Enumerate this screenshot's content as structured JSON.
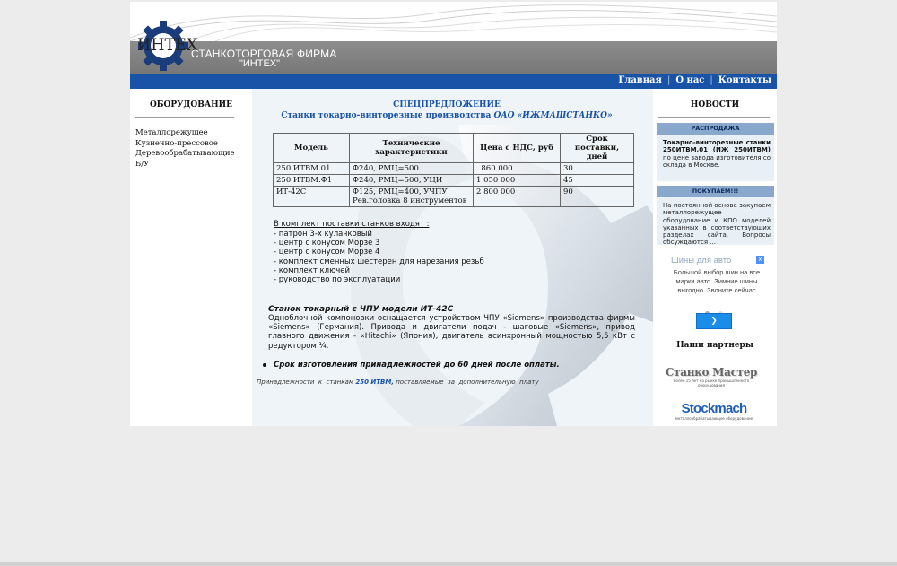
{
  "header": {
    "logo_text": "ИНТЕХ",
    "firm_line1": "СТАНКОТОРГОВАЯ ФИРМА",
    "firm_line2": "\"ИНТЕХ\""
  },
  "nav": {
    "items": [
      {
        "label": "Главная"
      },
      {
        "label": "О нас"
      },
      {
        "label": "Контакты"
      }
    ]
  },
  "sidebar": {
    "title": "ОБОРУДОВАНИЕ",
    "items": [
      {
        "label": "Металлорежущее"
      },
      {
        "label": "Кузнечно-прессовое"
      },
      {
        "label": "Деревообрабатывающие"
      },
      {
        "label": "Б/У"
      }
    ]
  },
  "main": {
    "title": "СПЕЦПРЕДЛОЖЕНИЕ",
    "subtitle": "Станки токарно-винторезные  производства",
    "subtitle_company": "ОАО «ИЖМАШСТАНКО»",
    "table": {
      "headers": [
        "Модель",
        "Технические характеристики",
        "Цена   с  НДС, руб",
        "Срок поставки, дней"
      ],
      "rows": [
        [
          "250 ИТВМ.01",
          "Ф240, РМЦ=500",
          "  860 000",
          "30"
        ],
        [
          "250 ИТВМ.Ф1",
          "Ф240, РМЦ=500, УЦИ",
          "1 050 000",
          "45"
        ],
        [
          "ИТ-42С",
          "Ф125, РМЦ=400, УЧПУ Рев.головка 8 инструментов",
          "2 800 000",
          "90"
        ]
      ]
    },
    "kit_title": "В комплект поставки станков  входят :",
    "kit_items": [
      "- патрон 3-х кулачковый",
      "- центр с конусом Морзе 3",
      "- центр с конусом Морзе 4",
      "- комплект сменных шестерен для нарезания резьб",
      "- комплект ключей",
      "- руководство по эксплуатации"
    ],
    "cnc_title": "Станок токарный с ЧПУ  модели  ИТ-42С",
    "cnc_text": "Одноблочной  компоновки оснащается устройством ЧПУ «Siemens»  производства фирмы «Siemens»  (Германия). Привода и двигатели подач - шаговые «Siemens», привод главного движения - «Hitachi» (Япония), двигатель асинхронный мощностью 5,5 кВт с редуктором  ¼.",
    "term": "Срок изготовления принадлежностей до 60 дней после  оплаты.",
    "footnote_pre": "Принадлежности  к  станкам ",
    "footnote_bold": "250 ИТВМ,",
    "footnote_post": " поставляемые  за  дополнительную  плату"
  },
  "news": {
    "title": "НОВОСТИ",
    "items": [
      {
        "head": "РАСПРОДАЖА",
        "body_bold": "Токарно-винторезные станки 250ИТВМ.01 (ИЖ 250ИТВМ)",
        "body": " по цене завода изготовителя со склада в Москве."
      },
      {
        "head": "ПОКУПАЕМ!!!",
        "body_bold": "",
        "body": "На постоянной основе закупаем металлорежущее оборудование и КПО моделей указанных в соответствующих разделах сайта. Вопросы обсуждаются ..."
      }
    ]
  },
  "ad": {
    "headline": "Шины для авто",
    "text": "Большой выбор шин на все марки авто. Зимние шины выгодно. Звоните сейчас",
    "close_glyph": "x",
    "button_glyph": "❯",
    "dot_active": "#aaaaaa",
    "dot_inactive": "#dddddd"
  },
  "partners": {
    "title": "Наши партнеры",
    "p1_name": "Станко Мастер",
    "p1_sub": "Более 15 лет на рынке промышленного оборудования",
    "p2_name": "Stockmach",
    "p2_sub": "металлообрабатывающее оборудование"
  },
  "colors": {
    "nav_bg": "#1853a8",
    "accent_blue": "#1853a8",
    "news_head": "#8aa8cc",
    "ad_button": "#1a8de9"
  }
}
